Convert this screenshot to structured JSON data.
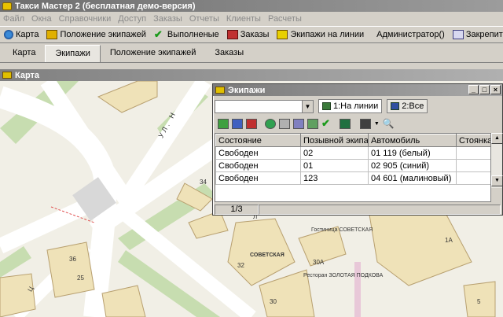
{
  "app": {
    "title": "Такси Мастер 2 (бесплатная демо-версия)"
  },
  "menu": [
    "Файл",
    "Окна",
    "Справочники",
    "Доступ",
    "Заказы",
    "Отчеты",
    "Клиенты",
    "Расчеты"
  ],
  "toolbar": {
    "map": "Карта",
    "crew_position": "Положение экипажей",
    "completed": "Выполненые",
    "orders": "Заказы",
    "crews_online": "Экипажи на линии",
    "user": "Администратор()",
    "pin": "Закрепить"
  },
  "tabs": [
    "Карта",
    "Экипажи",
    "Положение экипажей",
    "Заказы"
  ],
  "mdi_title": "Карта",
  "map_labels": {
    "street": "УЛ. Н",
    "b34": "34",
    "b32": "32",
    "b30a": "30А",
    "b30": "30",
    "b36": "36",
    "b25": "25",
    "b1a": "1А",
    "b5": "5",
    "hotel": "Гостиница СОВЕТСКАЯ",
    "sovetskaya": "СОВЕТСКАЯ",
    "restaurant": "Ресторан ЗОЛОТАЯ ПОДКОВА",
    "l": "Л",
    "ts": "Ц"
  },
  "crews_window": {
    "title": "Экипажи",
    "combo_value": "",
    "tab_online": "1:На линии",
    "tab_all": "2:Все",
    "columns": [
      "Состояние",
      "Позывной экипа...",
      "Автомобиль",
      "Стоянка"
    ],
    "rows": [
      [
        "Свободен",
        "02",
        "01 119 (белый)",
        ""
      ],
      [
        "Свободен",
        "01",
        "02 905 (синий)",
        ""
      ],
      [
        "Свободен",
        "123",
        "04 601 (малиновый)",
        ""
      ]
    ],
    "status_page": "1/3"
  },
  "colors": {
    "green_road": "#c7ddb0",
    "building": "#efe2b8",
    "building_border": "#b8a070",
    "road": "#ffffff"
  }
}
